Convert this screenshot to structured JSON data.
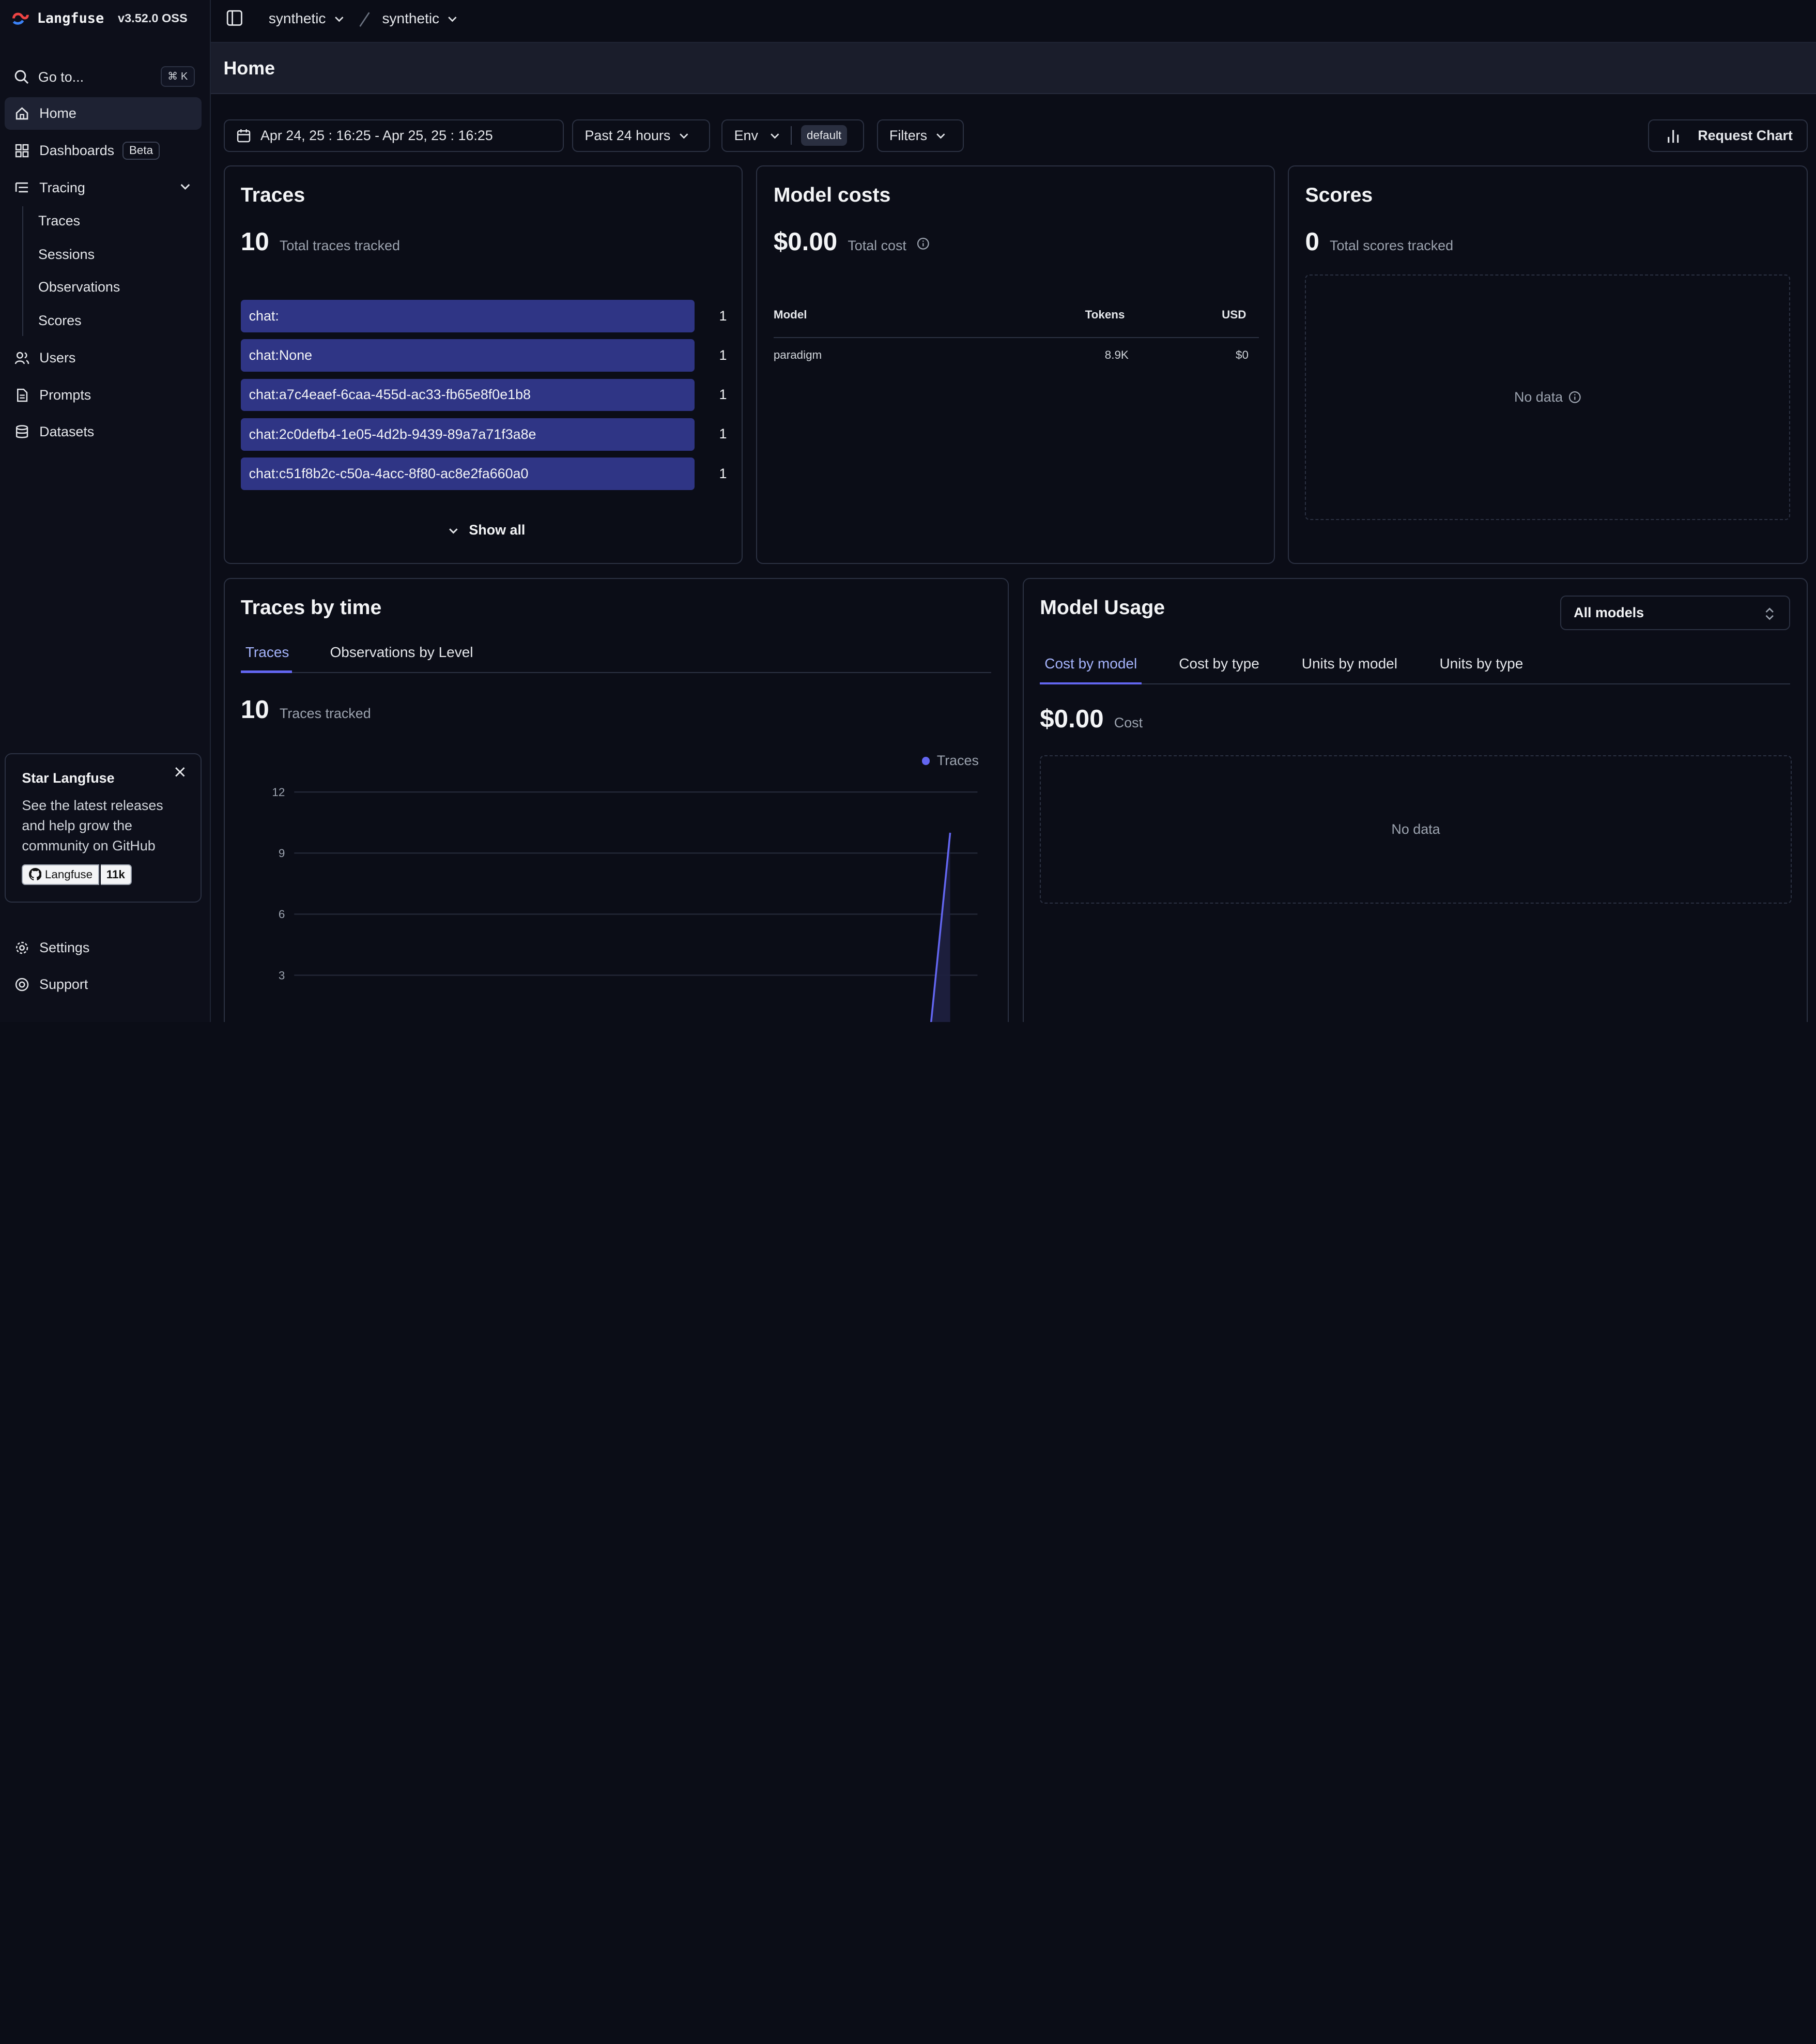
{
  "app": {
    "name": "Langfuse",
    "version": "v3.52.0 OSS"
  },
  "breadcrumb": {
    "organization": "synthetic",
    "project": "synthetic"
  },
  "sidebar": {
    "goto_label": "Go to...",
    "goto_shortcut": "⌘ K",
    "items": [
      {
        "label": "Home",
        "icon": "home-icon"
      },
      {
        "label": "Dashboards",
        "icon": "dashboard-icon",
        "badge": "Beta"
      },
      {
        "label": "Tracing",
        "icon": "tracing-icon"
      },
      {
        "label": "Users",
        "icon": "users-icon"
      },
      {
        "label": "Prompts",
        "icon": "prompts-icon"
      },
      {
        "label": "Datasets",
        "icon": "database-icon"
      }
    ],
    "tracing_sub": [
      "Traces",
      "Sessions",
      "Observations",
      "Scores"
    ],
    "bottom": [
      {
        "label": "Settings",
        "icon": "gear-icon"
      },
      {
        "label": "Support",
        "icon": "support-icon"
      }
    ]
  },
  "star_card": {
    "title": "Star Langfuse",
    "description": "See the latest releases and help grow the community on GitHub",
    "gh_label": "Langfuse",
    "gh_count": "11k"
  },
  "page": {
    "title": "Home"
  },
  "filters": {
    "date_range": "Apr 24, 25 : 16:25 - Apr 25, 25 : 16:25",
    "period": "Past 24 hours",
    "env_label": "Env",
    "env_value": "default",
    "filters_label": "Filters",
    "request_chart": "Request Chart"
  },
  "traces_card": {
    "title": "Traces",
    "total": "10",
    "total_label": "Total traces tracked",
    "rows": [
      {
        "name": "chat:",
        "count": "1"
      },
      {
        "name": "chat:None",
        "count": "1"
      },
      {
        "name": "chat:a7c4eaef-6caa-455d-ac33-fb65e8f0e1b8",
        "count": "1"
      },
      {
        "name": "chat:2c0defb4-1e05-4d2b-9439-89a7a71f3a8e",
        "count": "1"
      },
      {
        "name": "chat:c51f8b2c-c50a-4acc-8f80-ac8e2fa660a0",
        "count": "1"
      }
    ],
    "show_all": "Show all"
  },
  "model_costs": {
    "title": "Model costs",
    "total": "$0.00",
    "total_label": "Total cost",
    "headers": {
      "model": "Model",
      "tokens": "Tokens",
      "usd": "USD"
    },
    "rows": [
      {
        "model": "paradigm",
        "tokens": "8.9K",
        "usd": "$0"
      }
    ]
  },
  "scores": {
    "title": "Scores",
    "total": "0",
    "total_label": "Total scores tracked",
    "no_data": "No data"
  },
  "traces_by_time": {
    "title": "Traces by time",
    "tabs": [
      "Traces",
      "Observations by Level"
    ],
    "active_tab": 0,
    "total": "10",
    "total_label": "Traces tracked",
    "legend": "Traces"
  },
  "model_usage": {
    "title": "Model Usage",
    "select": "All models",
    "tabs": [
      "Cost by model",
      "Cost by type",
      "Units by model",
      "Units by type"
    ],
    "active_tab": 0,
    "total": "$0.00",
    "total_label": "Cost",
    "no_data": "No data"
  },
  "colors": {
    "accent": "#6366f1",
    "bar": "#2f3585",
    "background": "#0b0d17"
  },
  "chart_data": {
    "type": "line",
    "ylim": [
      0,
      12
    ],
    "yticks": [
      "12",
      "9",
      "6",
      "3"
    ],
    "series": [
      {
        "name": "Traces",
        "points": [
          [
            0.93,
            0
          ],
          [
            0.96,
            10
          ]
        ]
      }
    ]
  }
}
